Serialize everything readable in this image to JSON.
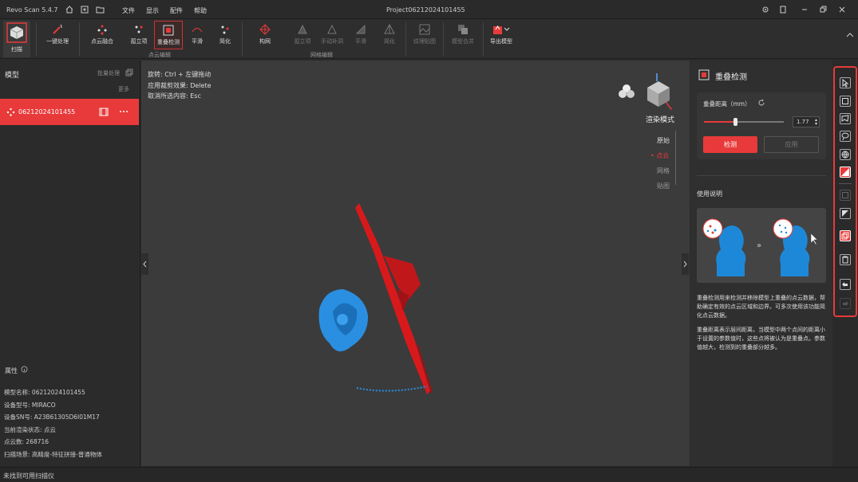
{
  "app": {
    "title": "Revo Scan 5.4.7",
    "project_title": "Project06212024101455"
  },
  "menu": [
    "文件",
    "显示",
    "配件",
    "帮助"
  ],
  "toolbar": {
    "scan_label": "扫描",
    "one_click_label": "一键处理",
    "fusion_label": "点云融合",
    "isolate_label": "孤立项",
    "overlap_label": "重叠检测",
    "smooth_label": "平滑",
    "simplify_label": "简化",
    "mesh_label": "构网",
    "mesh_isolate_label": "孤立项",
    "manual_fill_label": "手动补洞",
    "mesh_smooth_label": "平滑",
    "mesh_simplify_label": "简化",
    "texture_label": "纹理贴图",
    "merge_label": "模型合并",
    "export_label": "导出模型",
    "group_pointcloud": "点云编辑",
    "group_mesh": "网格编辑"
  },
  "left": {
    "models_title": "模型",
    "batch_label": "批量处理",
    "more_label": "更多",
    "model_item": "06212024101455",
    "properties_title": "属性",
    "props": [
      {
        "k": "模型名称:",
        "v": "06212024101455"
      },
      {
        "k": "设备型号:",
        "v": "MIRACO"
      },
      {
        "k": "设备SN号:",
        "v": "A23B61305D6I01M17"
      },
      {
        "k": "当前渲染状态:",
        "v": "点云"
      },
      {
        "k": "点云数:",
        "v": "268716"
      },
      {
        "k": "扫描场景:",
        "v": "高精度-特征拼接-普通物体"
      }
    ]
  },
  "viewport": {
    "hints": [
      "旋转: Ctrl + 左键拖动",
      "应用裁剪效果: Delete",
      "取消所选内容: Esc"
    ],
    "render_mode_title": "渲染模式",
    "render_modes": [
      "原始",
      "点云",
      "网格",
      "贴图"
    ],
    "active_mode": "点云"
  },
  "right": {
    "title": "重叠检测",
    "distance_label": "重叠距离（mm）",
    "distance_value": "1.77",
    "slider_fraction": 0.39,
    "detect_button": "检测",
    "apply_button": "应用",
    "usage_title": "使用说明",
    "desc1": "重叠检测用来检测并移除模型上重叠的点云数据，帮助确定有效的点云区域和边界。可多次使用该功能简化点云数据。",
    "desc2": "重叠距离表示层间距离，当模型中两个点间的距离小于设置的参数值时，这些点将被认为是重叠点。参数值越大，检测到的重叠部分越多。"
  },
  "status": {
    "text": "未找到可用扫描仪"
  },
  "colors": {
    "accent": "#e83a3a",
    "model_red": "#d8191c",
    "model_blue": "#2a8fe0"
  }
}
